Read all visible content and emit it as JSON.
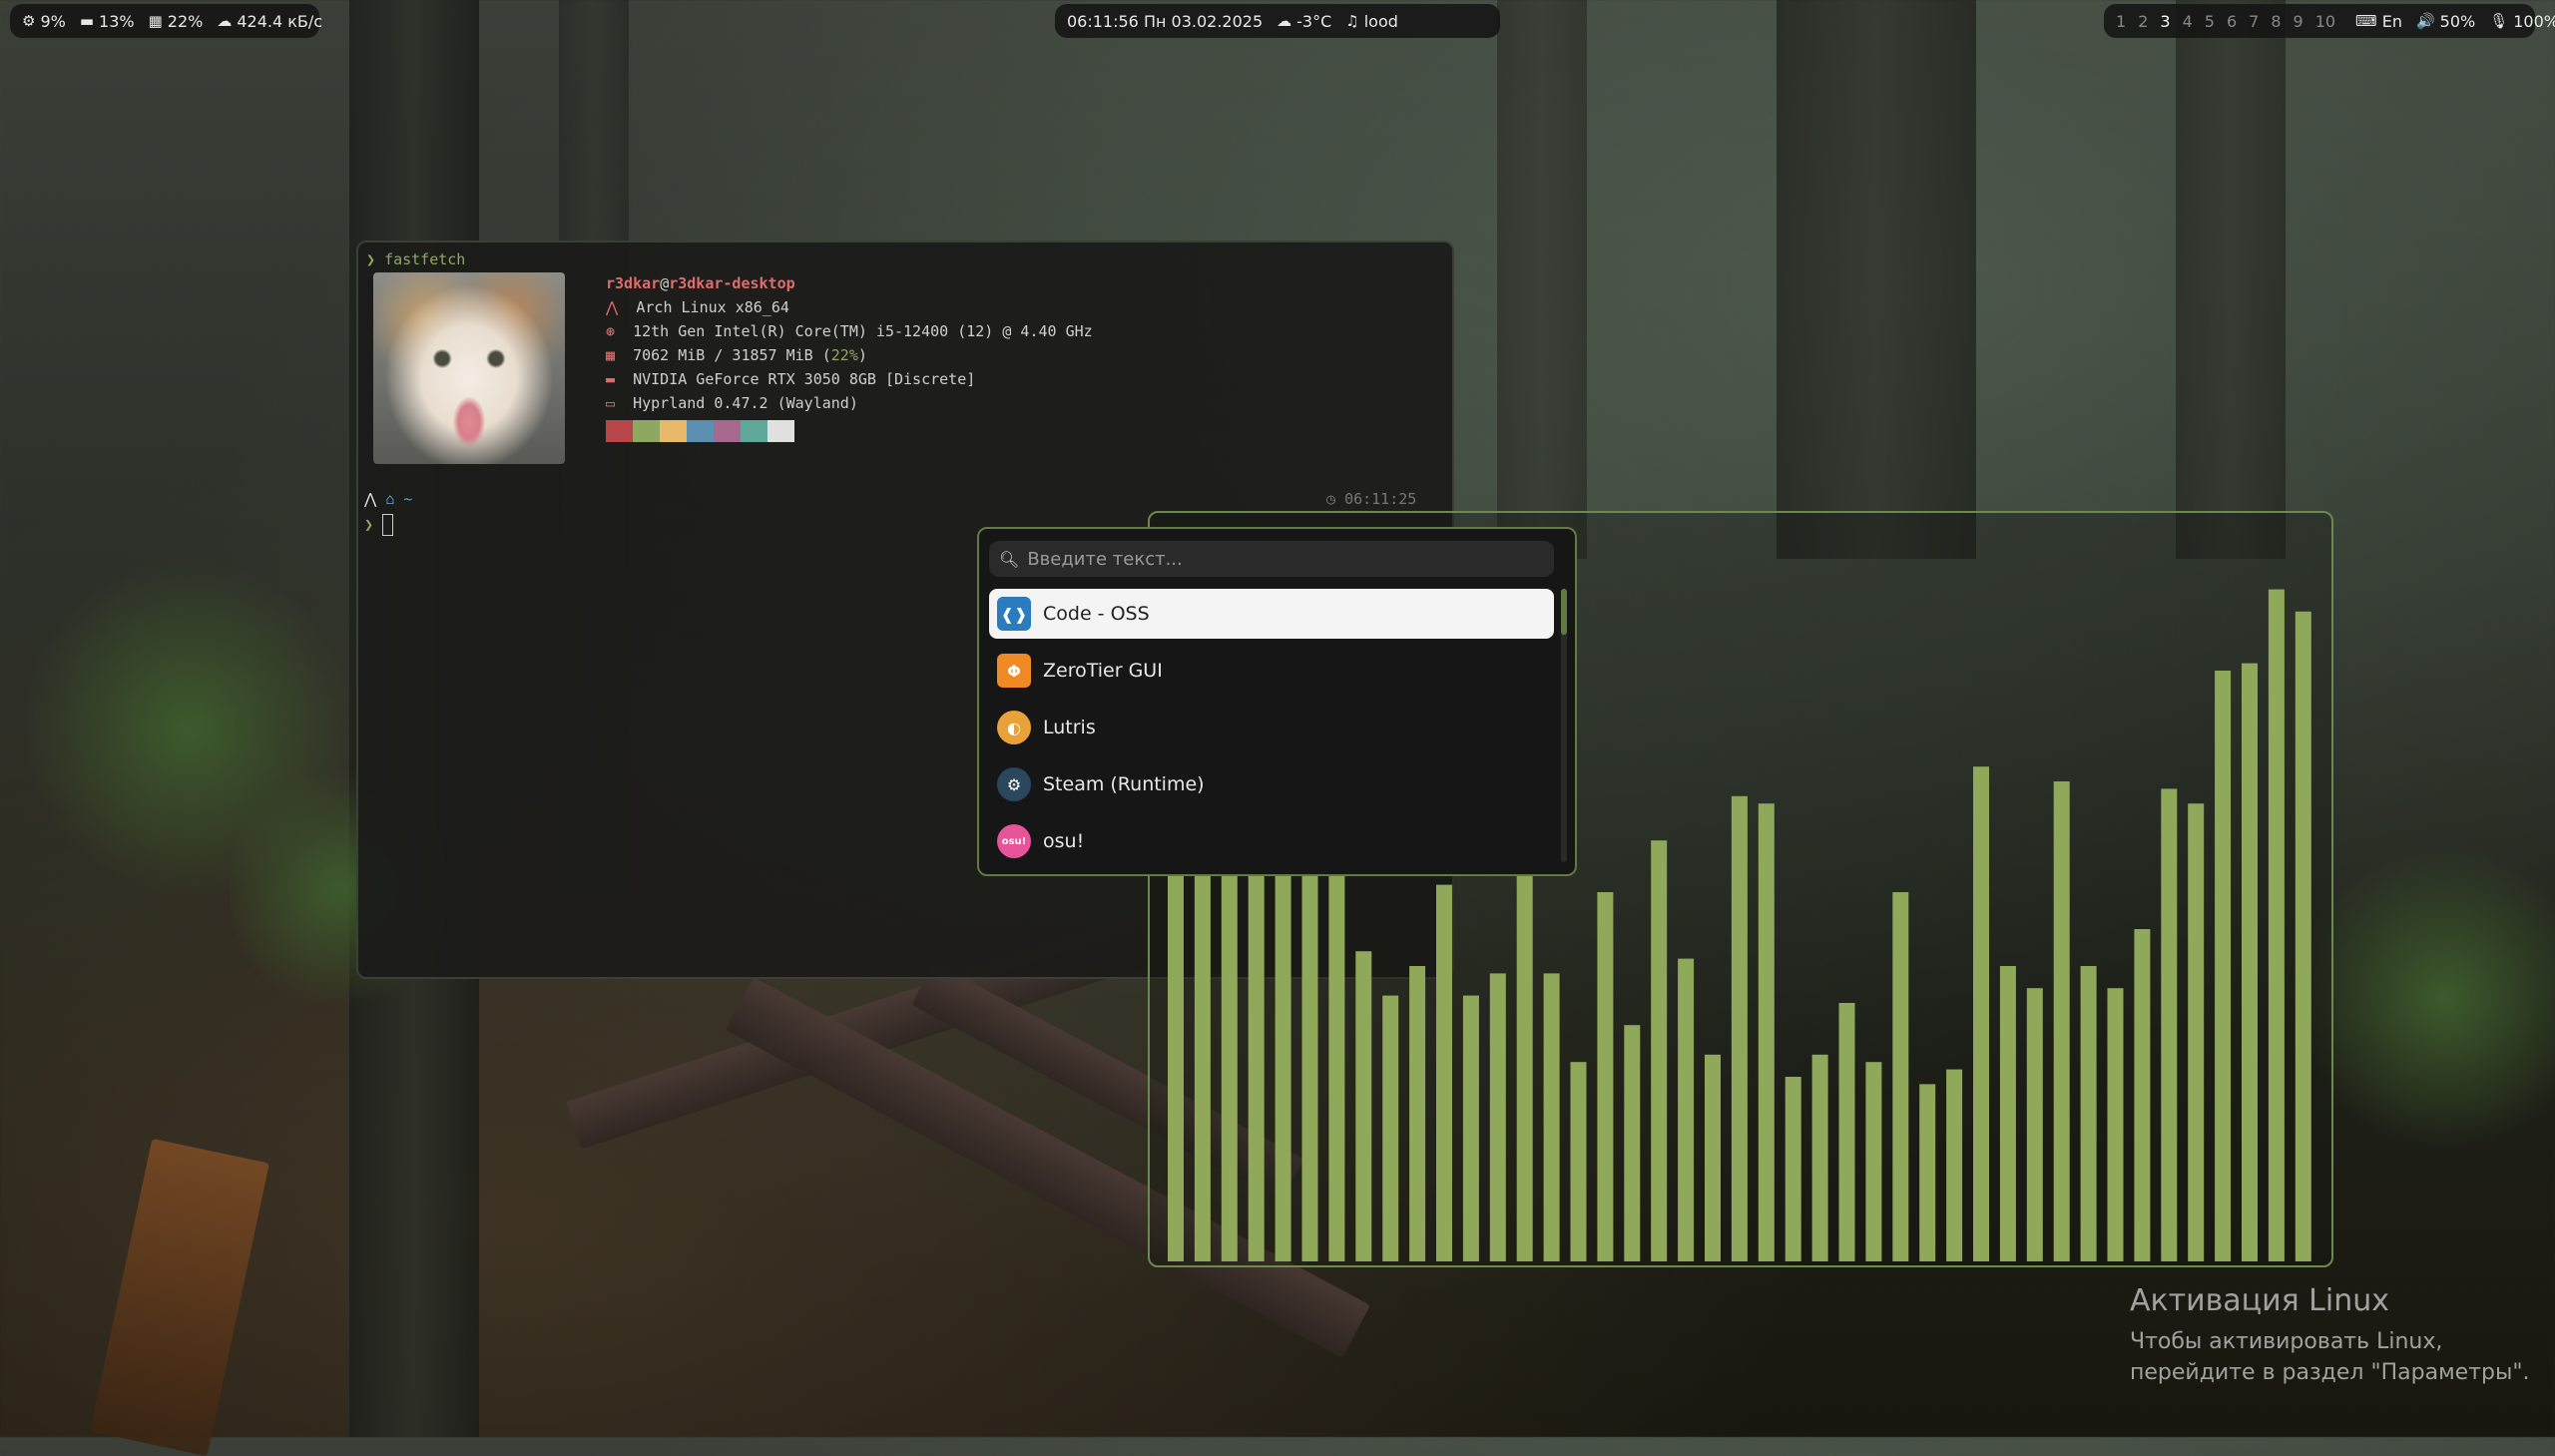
{
  "topbar": {
    "left": {
      "cpu": "9%",
      "gpu": "13%",
      "memory": "22%",
      "network": "424.4 кБ/с"
    },
    "center": {
      "clock": "06:11:56 Пн 03.02.2025",
      "weather": "-3°C",
      "music": "lood"
    },
    "right": {
      "workspaces": [
        "1",
        "2",
        "3",
        "4",
        "5",
        "6",
        "7",
        "8",
        "9",
        "10"
      ],
      "active_workspace": "3",
      "layout": "En",
      "volume": "50%",
      "mic": "100%"
    }
  },
  "terminal": {
    "command_prompt": "❯",
    "command": "fastfetch",
    "user": "r3dkar",
    "at": "@",
    "host": "r3dkar-desktop",
    "os": "Arch Linux x86_64",
    "cpu": "12th Gen Intel(R) Core(TM) i5-12400 (12) @ 4.40 GHz",
    "memory_prefix": "7062 MiB / 31857 MiB (",
    "memory_percent": "22%",
    "memory_suffix": ")",
    "gpu": "NVIDIA GeForce RTX 3050 8GB [Discrete]",
    "wm": "Hyprland 0.47.2 (Wayland)",
    "prompt_dir": "~",
    "prompt_time": "06:11:25",
    "palette": [
      "#b8454a",
      "#8fa861",
      "#e8b86b",
      "#5c8fb0",
      "#a8698f",
      "#5fa89a",
      "#e0e0e0"
    ]
  },
  "launcher": {
    "search_placeholder": "Введите текст...",
    "apps": [
      {
        "label": "Code - OSS",
        "icon": "vscode-icon",
        "color": "#2b7bbf"
      },
      {
        "label": "ZeroTier GUI",
        "icon": "zerotier-icon",
        "color": "#f08a24"
      },
      {
        "label": "Lutris",
        "icon": "lutris-icon",
        "color": "#e8a23a"
      },
      {
        "label": "Steam (Runtime)",
        "icon": "steam-icon",
        "color": "#2a475e"
      },
      {
        "label": "osu!",
        "icon": "osu-icon",
        "color": "#e8549a"
      }
    ],
    "selected_index": 0,
    "accent": "#5d7b43"
  },
  "visualizer": {
    "bar_color": "#8fa85a",
    "levels": [
      0.92,
      0.78,
      0.9,
      0.92,
      0.88,
      0.63,
      0.63,
      0.42,
      0.36,
      0.4,
      0.51,
      0.36,
      0.39,
      0.74,
      0.39,
      0.27,
      0.5,
      0.32,
      0.57,
      0.41,
      0.28,
      0.63,
      0.62,
      0.25,
      0.28,
      0.35,
      0.27,
      0.5,
      0.24,
      0.26,
      0.67,
      0.4,
      0.37,
      0.65,
      0.4,
      0.37,
      0.45,
      0.64,
      0.62,
      0.8,
      0.81,
      0.91,
      0.88
    ]
  },
  "activation": {
    "title": "Активация Linux",
    "line1": "Чтобы активировать Linux,",
    "line2": "перейдите в раздел \"Параметры\"."
  }
}
